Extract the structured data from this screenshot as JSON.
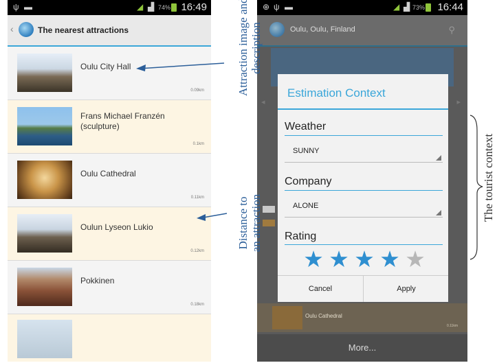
{
  "left_phone": {
    "status": {
      "pct": "74%",
      "time": "16:49"
    },
    "title": "The nearest attractions",
    "items": [
      {
        "name": "Oulu City Hall",
        "distance": "0.09km"
      },
      {
        "name": "Frans Michael Franzén (sculpture)",
        "distance": "0.1km"
      },
      {
        "name": "Oulu Cathedral",
        "distance": "0.11km"
      },
      {
        "name": "Oulun Lyseon Lukio",
        "distance": "0.12km"
      },
      {
        "name": "Pokkinen",
        "distance": "0.18km"
      }
    ]
  },
  "right_phone": {
    "status": {
      "pct": "73%",
      "time": "16:44"
    },
    "title": "Oulu, Oulu, Finland",
    "dialog": {
      "title": "Estimation Context",
      "weather_label": "Weather",
      "weather_value": "SUNNY",
      "company_label": "Company",
      "company_value": "ALONE",
      "rating_label": "Rating",
      "rating": 4,
      "rating_max": 5,
      "cancel": "Cancel",
      "apply": "Apply"
    },
    "bg_item": {
      "name": "Oulu Cathedral",
      "distance": "0.11km"
    },
    "more": "More..."
  },
  "annotations": {
    "image_desc_1": "Attraction image and",
    "image_desc_2": "description",
    "distance_1": "Distance to",
    "distance_2": "an attraction",
    "context": "The tourist context"
  },
  "colors": {
    "accent": "#3aa6d9",
    "annotation": "#2b5e99",
    "star_on": "#2f8fd0",
    "star_off": "#b7b7b7"
  },
  "icons": [
    "usb-icon",
    "image-icon",
    "wifi-icon",
    "signal-icon",
    "battery-icon",
    "globe-icon",
    "back-chevron-icon",
    "search-icon",
    "location-icon",
    "star-icon"
  ]
}
